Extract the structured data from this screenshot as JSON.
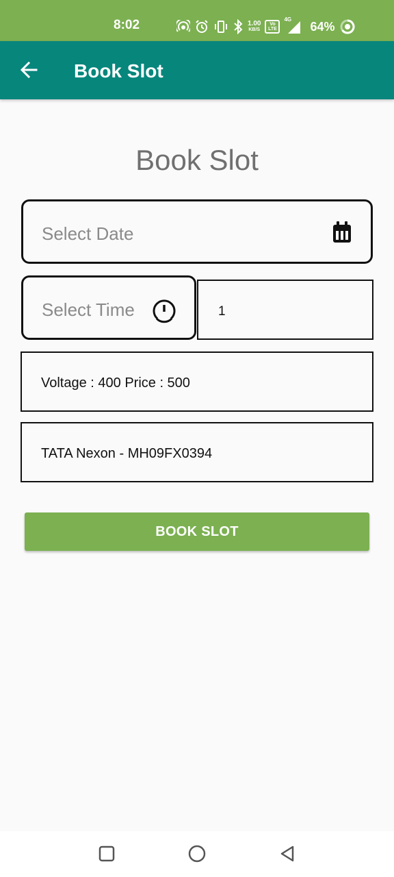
{
  "status_bar": {
    "time": "8:02",
    "speed_value": "1.00",
    "speed_unit": "KB/S",
    "volte_label": "Vo LTE",
    "network_label": "4G",
    "battery_percent": "64%",
    "icons": [
      "hotspot-icon",
      "alarm-icon",
      "vibrate-icon",
      "bluetooth-icon",
      "signal-icon",
      "battery-ring-icon"
    ]
  },
  "app_bar": {
    "title": "Book Slot",
    "back_icon": "arrow-left-icon"
  },
  "form": {
    "heading": "Book Slot",
    "date_placeholder": "Select Date",
    "date_icon": "calendar-icon",
    "time_placeholder": "Select Time",
    "time_icon": "clock-icon",
    "quantity_value": "1",
    "voltage_price_text": "Voltage : 400 Price : 500",
    "vehicle_text": "TATA Nexon - MH09FX0394",
    "book_button_label": "BOOK SLOT"
  },
  "nav_bar": {
    "icons": [
      "recents-square-icon",
      "home-circle-icon",
      "back-triangle-icon"
    ]
  },
  "colors": {
    "status_bar": "#7cb051",
    "app_bar": "#07867c",
    "button": "#7cb051",
    "background": "#fafafa"
  }
}
